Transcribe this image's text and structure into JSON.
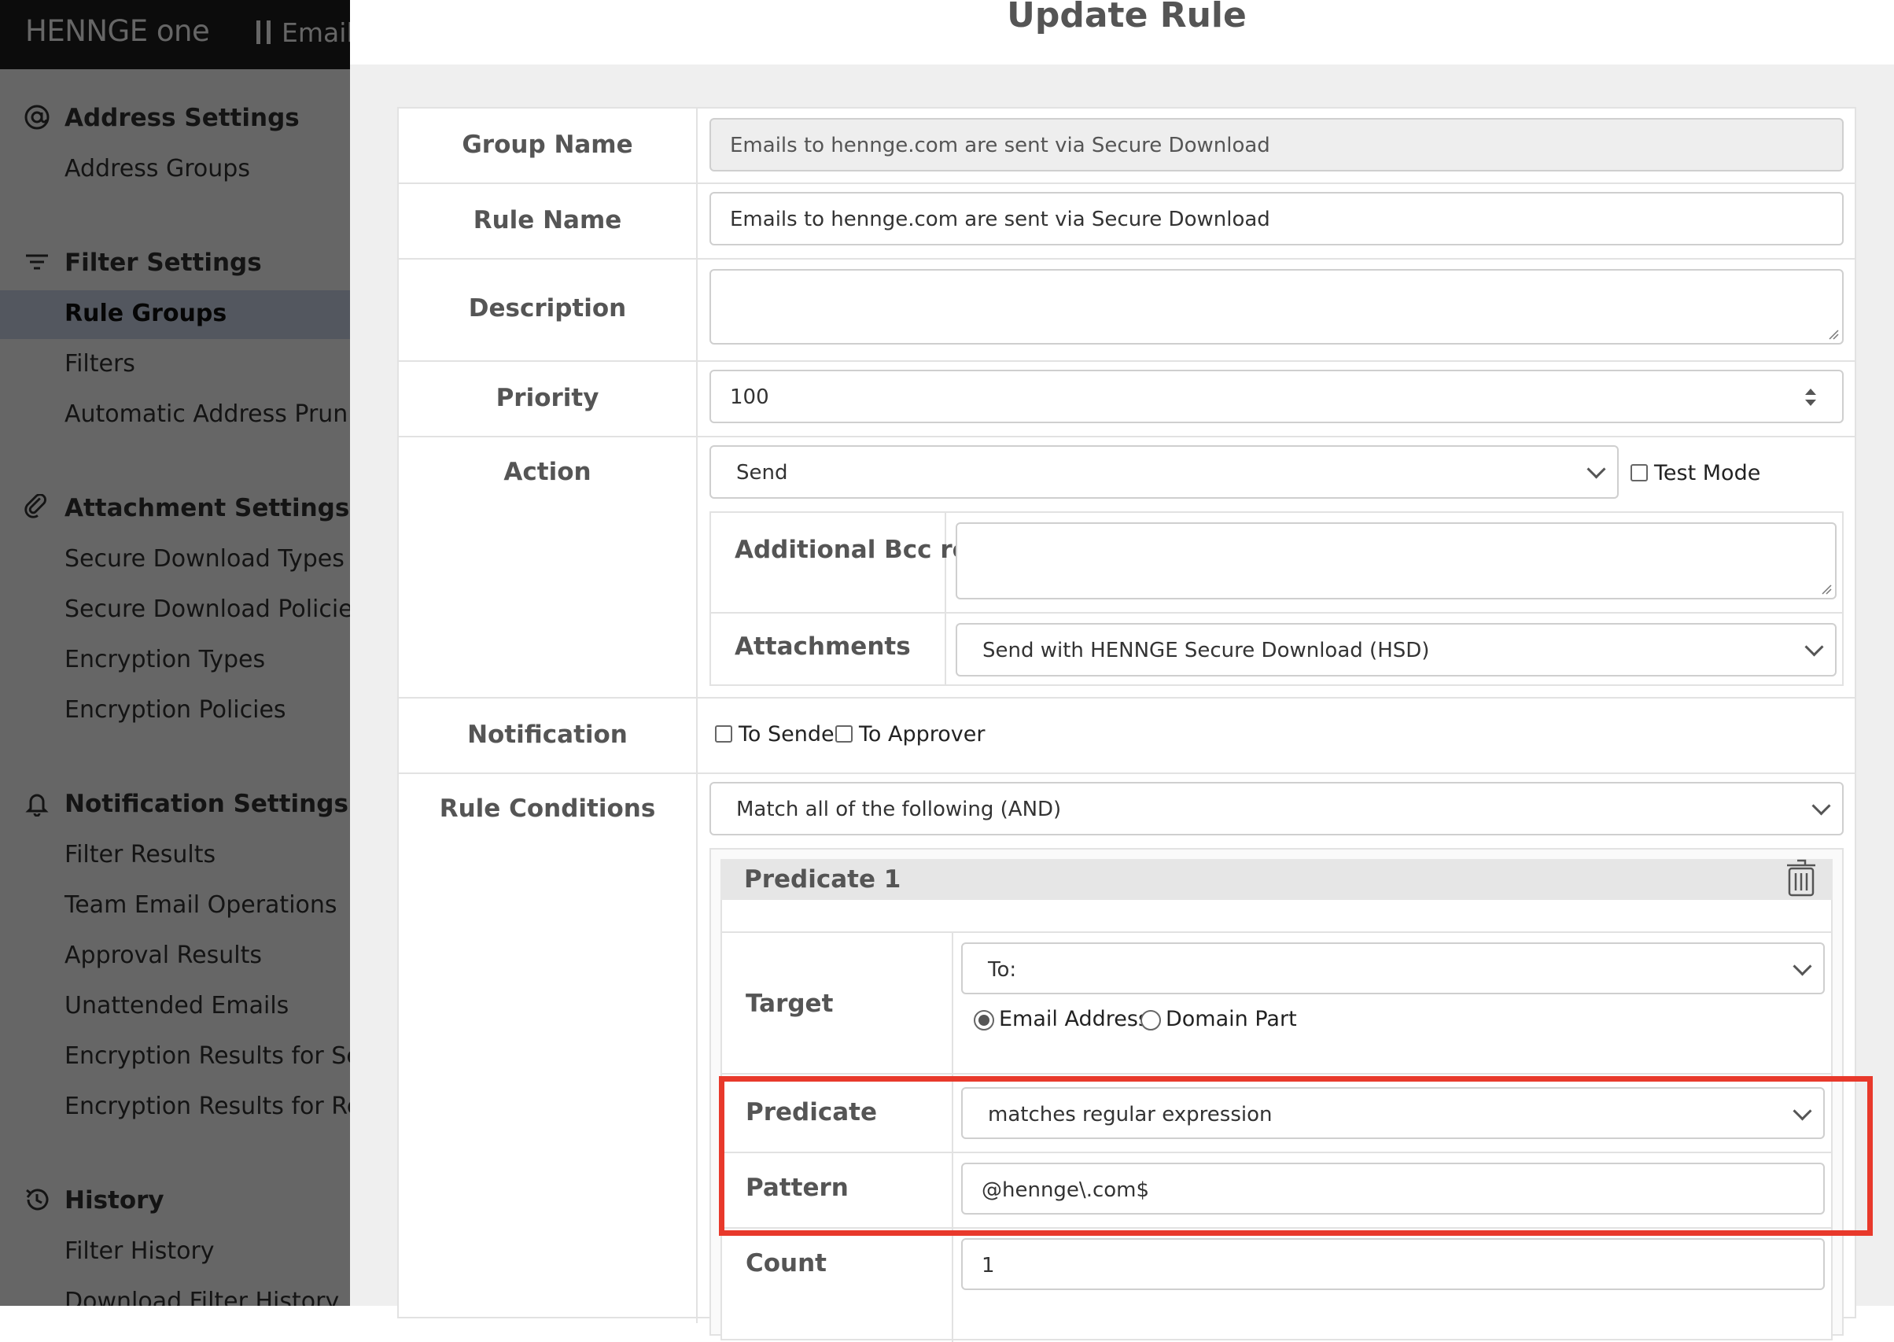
{
  "app": {
    "brand": "HENNGE one",
    "product": "Email",
    "sidebar": {
      "sections": [
        {
          "title": "Address Settings",
          "icon": "at-sign-icon"
        },
        {
          "title": "Filter Settings",
          "icon": "filter-icon"
        },
        {
          "title": "Attachment Settings",
          "icon": "paperclip-icon"
        },
        {
          "title": "Notification Settings",
          "icon": "bell-icon"
        },
        {
          "title": "History",
          "icon": "history-icon"
        }
      ],
      "items": [
        {
          "label": "Address Groups"
        },
        {
          "label": "Rule Groups",
          "active": true
        },
        {
          "label": "Filters"
        },
        {
          "label": "Automatic Address Pruning"
        },
        {
          "label": "Secure Download Types"
        },
        {
          "label": "Secure Download Policies"
        },
        {
          "label": "Encryption Types"
        },
        {
          "label": "Encryption Policies"
        },
        {
          "label": "Filter Results"
        },
        {
          "label": "Team Email Operations"
        },
        {
          "label": "Approval Results"
        },
        {
          "label": "Unattended Emails"
        },
        {
          "label": "Encryption Results for Senders"
        },
        {
          "label": "Encryption Results for Recipients"
        },
        {
          "label": "Filter History"
        },
        {
          "label": "Download Filter History"
        }
      ]
    }
  },
  "modal": {
    "title": "Update Rule",
    "fields": {
      "group_name": {
        "label": "Group Name",
        "value": "Emails to hennge.com  are sent via Secure Download"
      },
      "rule_name": {
        "label": "Rule Name",
        "value": "Emails to hennge.com  are sent via Secure Download"
      },
      "description": {
        "label": "Description",
        "value": ""
      },
      "priority": {
        "label": "Priority",
        "value": "100"
      },
      "action": {
        "label": "Action",
        "value": "Send",
        "test_mode_label": "Test Mode",
        "test_mode_checked": false,
        "bcc_label": "Additional Bcc recipients",
        "bcc_value": "",
        "attachments_label": "Attachments",
        "attachments_value": "Send with HENNGE Secure Download (HSD)"
      },
      "notification": {
        "label": "Notification",
        "to_sender_label": "To Sender",
        "to_approver_label": "To Approver"
      },
      "rule_conditions": {
        "label": "Rule Conditions",
        "match_value": "Match all of the following (AND)",
        "predicate_card": {
          "title": "Predicate 1",
          "target_label": "Target",
          "target_value": "To:",
          "radio_email": "Email Address",
          "radio_domain": "Domain Part",
          "selected_radio": "Email Address",
          "predicate_label": "Predicate",
          "predicate_value": "matches regular expression",
          "pattern_label": "Pattern",
          "pattern_value": "@hennge\\.com$",
          "count_label": "Count",
          "count_value": "1"
        }
      }
    }
  },
  "colors": {
    "highlight": "#e8392b",
    "topbar": "#1e1e1e",
    "active_nav": "#d0d9ee"
  }
}
